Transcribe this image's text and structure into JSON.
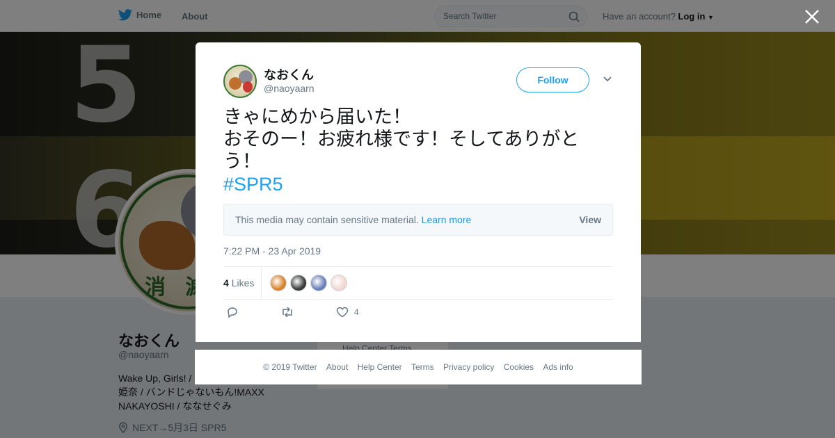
{
  "topnav": {
    "home_label": "Home",
    "about_label": "About",
    "search_placeholder": "Search Twitter",
    "have_account": "Have an account?",
    "login_label": "Log in"
  },
  "profile": {
    "name": "なおくん",
    "handle": "@naoyaarn",
    "bio_line1": "Wake Up, Girls! /",
    "bio_line2": "姫奈 / バンドじゃないもん!MAXX",
    "bio_line3": "NAKAYOSHI / ななせぐみ",
    "location": "NEXT→5月3日 SPR5",
    "avatar_text": "消 滅",
    "side_links": "Help Center   Terms"
  },
  "tweet": {
    "author_name": "なおくん",
    "author_handle": "@naoyaarn",
    "follow_label": "Follow",
    "text_line1": "きゃにめから届いた！",
    "text_line2": "おそのー！お疲れ様です！そしてありがと",
    "text_line3": "う！",
    "hashtag": "#SPR5",
    "sensitive_text": "This media may contain sensitive material.",
    "learn_more": "Learn more",
    "view_label": "View",
    "timestamp": "7:22 PM - 23 Apr 2019",
    "likes_count": "4",
    "likes_label": "Likes",
    "like_action_count": "4"
  },
  "likers": [
    {
      "name": "liker-1",
      "color": "#d9822b"
    },
    {
      "name": "liker-2",
      "color": "#3a3a3a"
    },
    {
      "name": "liker-3",
      "color": "#6a7fb8"
    },
    {
      "name": "liker-4",
      "color": "#f2d7d0"
    }
  ],
  "footer": {
    "copyright": "© 2019 Twitter",
    "about": "About",
    "help": "Help Center",
    "terms": "Terms",
    "privacy": "Privacy policy",
    "cookies": "Cookies",
    "ads": "Ads info"
  },
  "colors": {
    "accent": "#1da1f2",
    "muted": "#657786"
  }
}
